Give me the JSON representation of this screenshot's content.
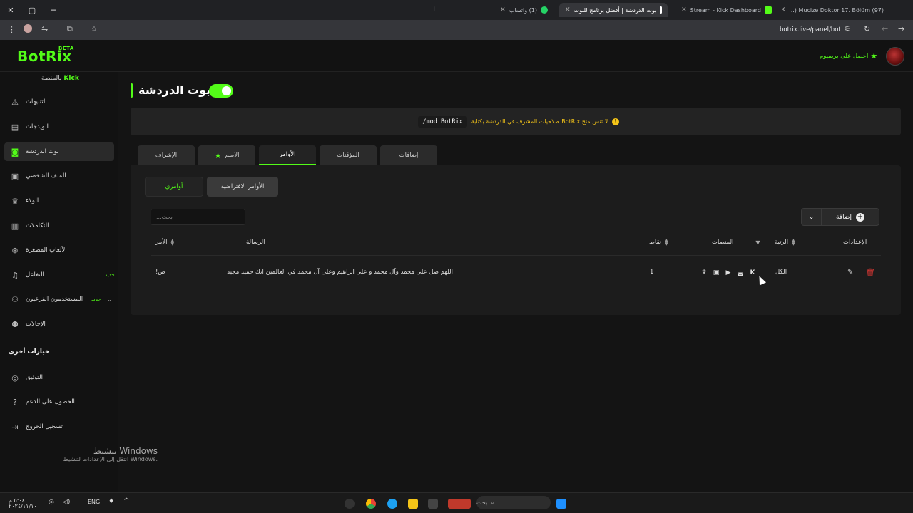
{
  "browser": {
    "tabs": [
      {
        "title": "(97) Mucize Doktor 17. Bölüm (...",
        "favicon_color": "#ff0000"
      },
      {
        "title": "Stream - Kick Dashboard",
        "favicon_color": "#53fc18"
      },
      {
        "title": "بوت الدردشة | أفضل برنامج للبوت",
        "favicon_color": "#ffffff"
      },
      {
        "title": "(1) واتساب",
        "favicon_color": "#25d366"
      }
    ],
    "url": "botrix.live/panel/bot"
  },
  "app": {
    "logo": "BotRix",
    "beta": "BETA",
    "premium": "احصل على بريميوم",
    "platform_label": "بالمنصة",
    "platform": "Kick"
  },
  "sidebar": {
    "items": [
      {
        "label": "التنبيهات",
        "icon": "warning-icon"
      },
      {
        "label": "الويدجات",
        "icon": "widget-icon"
      },
      {
        "label": "بوت الدردشة",
        "icon": "robot-icon"
      },
      {
        "label": "الملف الشخصي",
        "icon": "profile-card-icon"
      },
      {
        "label": "الولاء",
        "icon": "trophy-icon"
      },
      {
        "label": "التكاملات",
        "icon": "integration-icon"
      },
      {
        "label": "الألعاب المصغرة",
        "icon": "gamepad-icon"
      },
      {
        "label": "التفاعل",
        "icon": "music-icon",
        "badge": "جديد"
      },
      {
        "label": "المستخدمون الفرعيون",
        "icon": "users-icon",
        "badge": "جديد"
      },
      {
        "label": "الإحالات",
        "icon": "referral-icon"
      }
    ],
    "section_title": "خيارات أخرى",
    "other": [
      {
        "label": "التوثيق",
        "icon": "doc-icon"
      },
      {
        "label": "الحصول على الدعم",
        "icon": "help-icon"
      },
      {
        "label": "تسجيل الخروج",
        "icon": "logout-icon"
      }
    ]
  },
  "page": {
    "title": "بوت الدردشة",
    "enabled": true,
    "notice": {
      "text": "لا تنس منح BotRix صلاحيات المشرف في الدردشة بكتابة",
      "command": "/mod BotRix"
    },
    "tabs": [
      "الإشراف",
      "الاسم",
      "الأوامر",
      "المؤقتات",
      "إضافات"
    ],
    "subtabs": [
      "أوامري",
      "الأوامر الافتراضية"
    ],
    "search_placeholder": "بحث...",
    "add_label": "إضافة",
    "table": {
      "headers": {
        "command": "الأمر",
        "message": "الرسالة",
        "points": "نقاط",
        "platforms": "المنصات",
        "rank": "الرتبة",
        "settings": "الإعدادات"
      },
      "rows": [
        {
          "command": "!ص",
          "message": "اللهم صل على محمد وآل محمد و على ابراهيم وعلى آل محمد في العالمين انك حميد مجيد",
          "points": "1",
          "rank": "الكل",
          "platforms": [
            "kick-icon",
            "discord-icon",
            "youtube-icon",
            "twitch-icon",
            "trovo-icon"
          ]
        }
      ]
    }
  },
  "windows": {
    "watermark_title": "تنشيط Windows",
    "watermark_sub": "انتقل إلى الإعدادات لتنشيط Windows.",
    "search": "بحث",
    "lang": "ENG",
    "time": "٥:٠٤ م",
    "date": "٢٠٢٤/١١/١٠"
  }
}
